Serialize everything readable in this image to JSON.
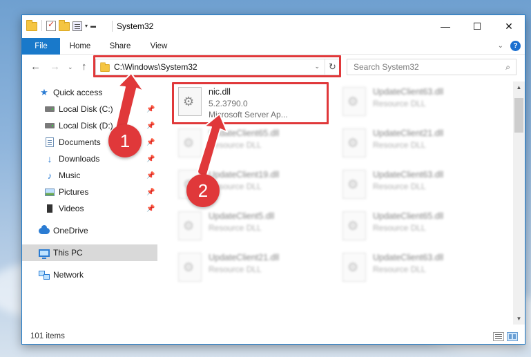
{
  "window": {
    "title": "System32",
    "caption": {
      "minimize": "—",
      "maximize": "☐",
      "close": "✕"
    }
  },
  "ribbon": {
    "tabs": [
      {
        "label": "File"
      },
      {
        "label": "Home"
      },
      {
        "label": "Share"
      },
      {
        "label": "View"
      }
    ],
    "help_label": "?"
  },
  "navigation": {
    "address": "C:\\Windows\\System32",
    "search_placeholder": "Search System32"
  },
  "sidebar": {
    "items": [
      {
        "label": "Quick access",
        "icon": "star-icon"
      },
      {
        "label": "Local Disk (C:)",
        "icon": "disk-icon",
        "pinned": true
      },
      {
        "label": "Local Disk (D:)",
        "icon": "disk-icon",
        "pinned": true
      },
      {
        "label": "Documents",
        "icon": "documents-icon",
        "pinned": true
      },
      {
        "label": "Downloads",
        "icon": "download-icon",
        "pinned": true
      },
      {
        "label": "Music",
        "icon": "music-icon",
        "pinned": true
      },
      {
        "label": "Pictures",
        "icon": "pictures-icon",
        "pinned": true
      },
      {
        "label": "Videos",
        "icon": "videos-icon",
        "pinned": true
      },
      {
        "label": "OneDrive",
        "icon": "cloud-icon"
      },
      {
        "label": "This PC",
        "icon": "computer-icon",
        "selected": true
      },
      {
        "label": "Network",
        "icon": "network-icon"
      }
    ]
  },
  "files": [
    {
      "name": "nic.dll",
      "line2": "5.2.3790.0",
      "line3": "Microsoft Server Ap...",
      "focused": true
    },
    {
      "name": "UpdateClient63.dll",
      "line2": "Resource DLL"
    },
    {
      "name": "UpdateClient65.dll",
      "line2": "Resource DLL"
    },
    {
      "name": "UpdateClient21.dll",
      "line2": "Resource DLL"
    },
    {
      "name": "UpdateClient19.dll",
      "line2": "Resource DLL"
    },
    {
      "name": "UpdateClient63.dll",
      "line2": "Resource DLL"
    },
    {
      "name": "UpdateClient5.dll",
      "line2": "Resource DLL"
    },
    {
      "name": "UpdateClient65.dll",
      "line2": "Resource DLL"
    },
    {
      "name": "UpdateClient21.dll",
      "line2": "Resource DLL"
    },
    {
      "name": "UpdateClient63.dll",
      "line2": "Resource DLL"
    }
  ],
  "status": {
    "item_count": "101 items"
  },
  "callouts": [
    {
      "number": "1"
    },
    {
      "number": "2"
    }
  ],
  "colors": {
    "accent": "#1979ca",
    "highlight": "#e0383a"
  }
}
